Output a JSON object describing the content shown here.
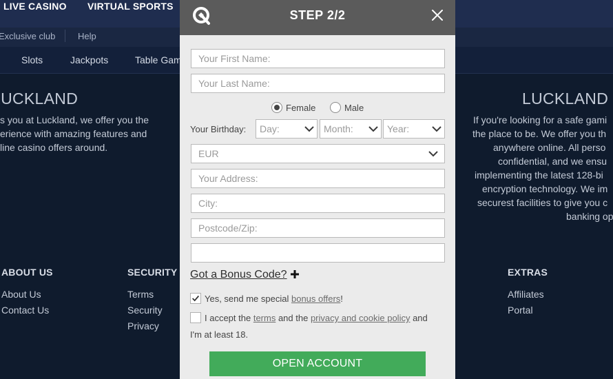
{
  "top_nav": {
    "live_casino": "LIVE CASINO",
    "virtual_sports": "VIRTUAL SPORTS"
  },
  "sub_nav": {
    "exclusive_club": "Exclusive club",
    "help": "Help"
  },
  "category_nav": {
    "slots": "Slots",
    "jackpots": "Jackpots",
    "table_games": "Table Gam"
  },
  "left_section": {
    "heading": "LUCKLAND",
    "lines": [
      "s you at Luckland, we offer you the",
      "erience with amazing features and",
      "line casino offers around."
    ]
  },
  "right_section": {
    "heading": "LUCKLAND S",
    "lines": [
      "If you're looking for a safe gami",
      "the place to be. We offer you th",
      "anywhere online. All perso",
      "confidential, and we ensu",
      "implementing the latest 128-bi",
      "encryption technology. We im",
      "securest facilities to give you c",
      "banking op"
    ]
  },
  "footer": {
    "about_us": {
      "heading": "ABOUT US",
      "links": [
        "About Us",
        "Contact Us"
      ]
    },
    "security": {
      "heading": "SECURITY &",
      "links": [
        "Terms",
        "Security",
        "Privacy"
      ]
    },
    "extras": {
      "heading": "EXTRAS",
      "links": [
        "Affiliates",
        "Portal"
      ]
    }
  },
  "modal": {
    "title": "STEP 2/2",
    "first_name_placeholder": "Your First Name:",
    "last_name_placeholder": "Your Last Name:",
    "gender": {
      "female": "Female",
      "male": "Male",
      "selected": "Female"
    },
    "birthday_label": "Your Birthday:",
    "day_placeholder": "Day:",
    "month_placeholder": "Month:",
    "year_placeholder": "Year:",
    "currency": "EUR",
    "address_placeholder": "Your Address:",
    "city_placeholder": "City:",
    "postcode_placeholder": "Postcode/Zip:",
    "blank_field_placeholder": "",
    "bonus_code_label": "Got a Bonus Code?",
    "offers": {
      "prefix": "Yes, send me special ",
      "link": "bonus offers",
      "suffix": "!",
      "checked": true
    },
    "terms": {
      "prefix": "I accept the ",
      "terms_link": "terms",
      "middle": " and the ",
      "privacy_link": "privacy and cookie policy",
      "suffix": " and",
      "line2": "I'm at least 18.",
      "checked": false
    },
    "submit_label": "OPEN ACCOUNT"
  },
  "colors": {
    "header": "#5b5b5b",
    "button": "#42ab5a",
    "page_bg": "#0f1b2d",
    "nav_bg": "#1f2d4f"
  }
}
